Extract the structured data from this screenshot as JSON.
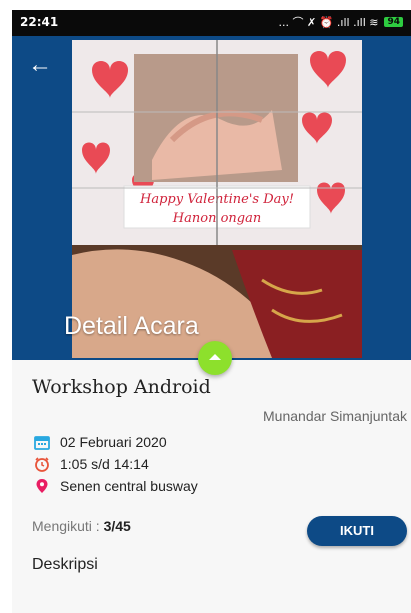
{
  "status_bar": {
    "time": "22:41",
    "icons_text": "... ⌒ ✗ ⏰ .ıll .ıll ≋",
    "battery": "94",
    "icons": [
      "headphones-icon",
      "mute-icon",
      "alarm-icon",
      "signal-icon",
      "signal-icon",
      "wifi-icon",
      "battery-icon"
    ]
  },
  "header": {
    "title": "Detail Acara",
    "color": "#0d4a86",
    "photo_caption_line1": "Happy Valentine's Day!",
    "photo_caption_line2": "Hanon ongan"
  },
  "event": {
    "name": "Workshop Android",
    "organizer": "Munandar Simanjuntak",
    "date": "02 Februari 2020",
    "time": "1:05 s/d 14:14",
    "location": "Senen central busway",
    "participants_label": "Mengikuti : ",
    "participants_value": "3/45",
    "join_label": "IKUTI",
    "description_label": "Deskripsi"
  },
  "colors": {
    "accent": "#0d4a86",
    "fab": "#8de02c",
    "date_icon": "#29a8e0",
    "time_icon": "#e8543a",
    "location_icon": "#e91e63"
  }
}
